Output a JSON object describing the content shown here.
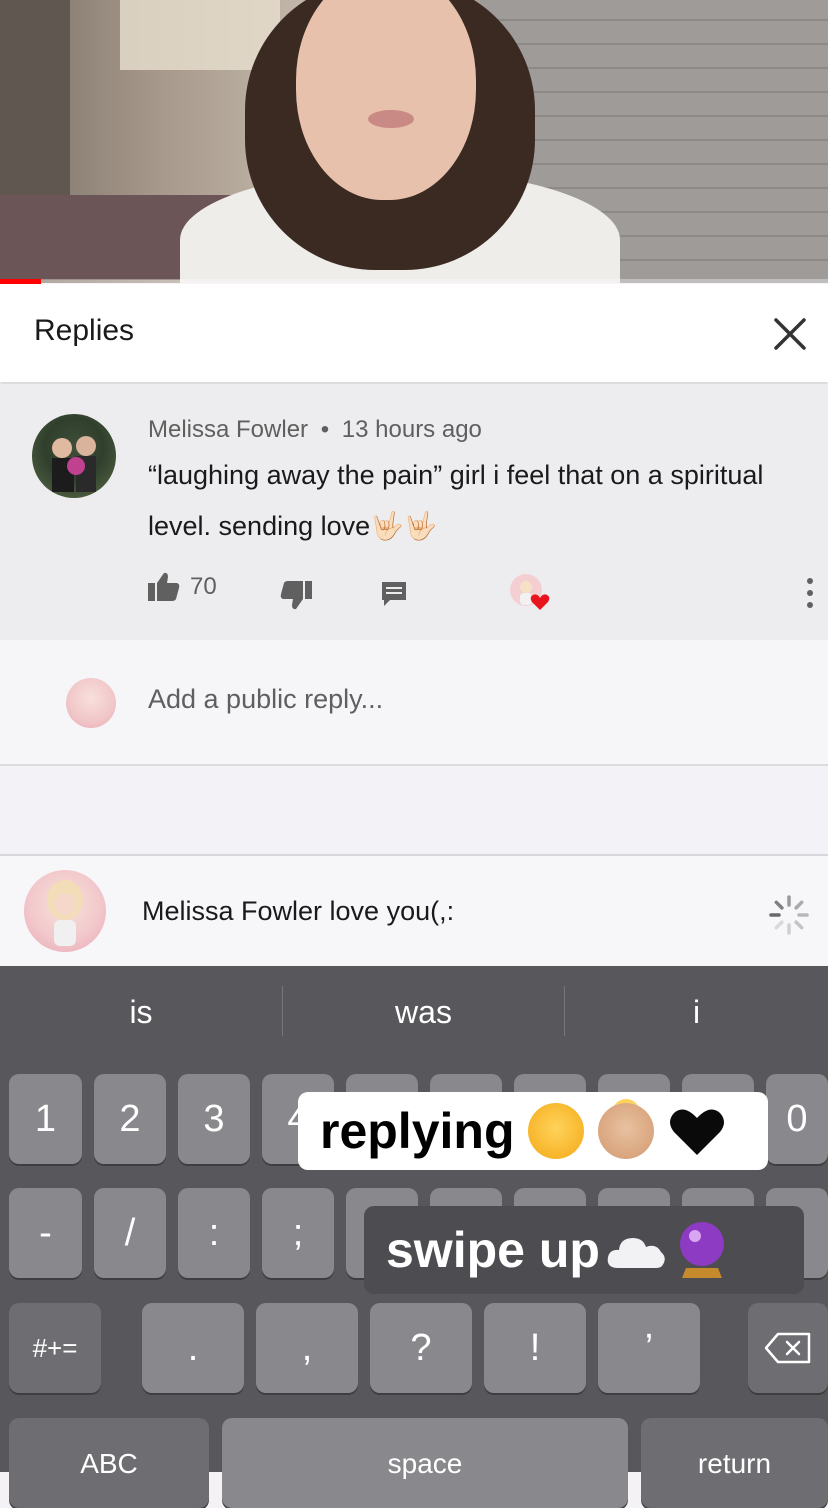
{
  "progress_fraction": 0.05,
  "replies": {
    "title": "Replies"
  },
  "comment": {
    "author": "Melissa Fowler",
    "separator": "•",
    "time": "13 hours ago",
    "text": "“laughing away the pain” girl i feel that on a spiritual level. sending love🤟🏻🤟🏻",
    "likes": "70"
  },
  "add_reply": {
    "placeholder": "Add a public reply..."
  },
  "compose": {
    "text": "Melissa Fowler love you(,:"
  },
  "keyboard": {
    "suggestions": [
      "is",
      "was",
      "i"
    ],
    "row1": [
      "1",
      "2",
      "3",
      "4",
      "",
      "",
      "",
      "",
      "",
      "0"
    ],
    "row2": [
      "-",
      "/",
      ":",
      ";",
      "",
      "",
      "",
      "",
      "",
      "\""
    ],
    "row3": [
      "#+=",
      ".",
      ",",
      "?",
      "!",
      "’"
    ],
    "abc": "ABC",
    "space": "space",
    "return": "return"
  },
  "stickers": {
    "replying": "replying",
    "swipe_up": "swipe up"
  },
  "colors": {
    "youtube_red": "#ff0000",
    "keyboard_bg": "#58575b",
    "key_bg": "#89888c"
  }
}
